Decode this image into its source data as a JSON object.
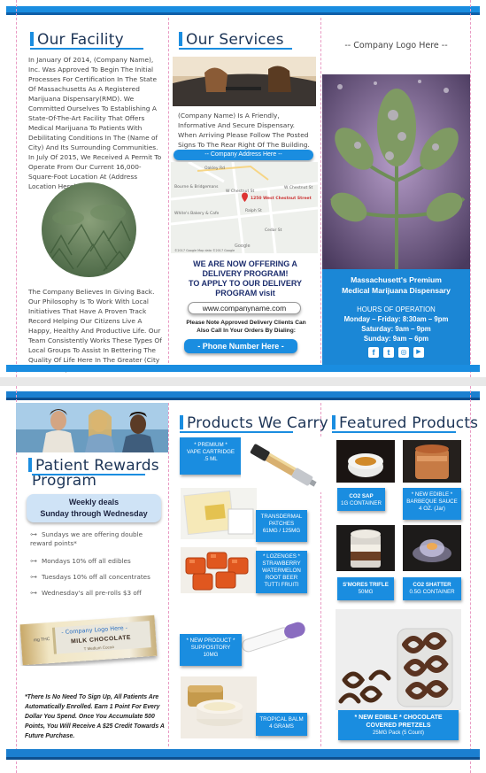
{
  "facility": {
    "title": "Our Facility",
    "text1": "In January Of 2014, (Company Name), Inc. Was Approved To Begin The Initial Processes For Certification In The State Of Massachusetts As A Registered Marijuana Dispensary(RMD). We Committed Ourselves To Establishing A State-Of-The-Art Facility That Offers Medical Marijuana To Patients With Debilitating Conditions In The (Name of City) And Its Surrounding Communities. In July Of 2015, We Received A Permit To Operate From Our Current 16,000-Square-Foot Location At (Address Location Here).",
    "text2": "The Company Believes In Giving Back. Our Philosophy Is To Work With Local Initiatives That Have A Proven Track Record Helping Our Citizens Live A Happy, Healthy And Productive Life. Our Team Consistently Works These Types Of Local Groups To Assist In Bettering The Quality Of Life Here In The Greater (City Name Here) Area."
  },
  "services": {
    "title": "Our Services",
    "text": "(Company Name) Is A Friendly, Informative And Secure Dispensary. When Arriving Please Follow The Posted Signs To The Rear Right Of The Building.",
    "address_pill": "-- Company Address Here --",
    "map": {
      "streets": [
        "W Chestnut St",
        "W Chestnut St",
        "Ralph St",
        "Cedar St",
        "Oakley Rd"
      ],
      "places": [
        "Bourne & Bridgemans",
        "White's Bakery & Cafe"
      ],
      "pin_label": "1250 West Chestnut Street",
      "google": "Google",
      "footer": "©2017 Google    Map data ©2017 Google"
    },
    "delivery_line1": "WE ARE NOW OFFERING A",
    "delivery_line2": "DELIVERY PROGRAM!",
    "delivery_line3": "TO APPLY TO OUR DELIVERY",
    "delivery_line4": "PROGRAM visit",
    "website": "www.companyname.com",
    "note": "Please Note Approved Delivery Clients Can Also Call In Your Orders By Dialing:",
    "phone": "- Phone Number Here -"
  },
  "cover": {
    "logo": "-- Company Logo Here --",
    "tag1": "Massachusett's Premium",
    "tag2": "Medical Marijuana Dispensary",
    "hours_title": "HOURS OF OPERATION",
    "hours1": "Monday – Friday: 8:30am – 9pm",
    "hours2": "Saturday: 9am – 9pm",
    "hours3": "Sunday: 9am – 6pm",
    "social": [
      "f",
      "t",
      "◎",
      "▶"
    ]
  },
  "rewards": {
    "title1": "Patient Rewards",
    "title2": "Program",
    "deals1": "Weekly deals",
    "deals2": "Sunday through Wednesday",
    "items": [
      "Sundays we are offering double reward points*",
      "Mondays 10% off all edibles",
      "Tuesdays 10% off all concentrates",
      "Wednesday's all pre-rolls $3 off"
    ],
    "bar_logo": "- Company Logo Here -",
    "bar_mg": "mg THC",
    "bar_text": "MILK CHOCOLATE",
    "bar_small": "T Medium Cocoa",
    "footnote": "*There Is No Need To Sign Up, All Patients Are Automatically Enrolled. Earn 1 Point For Every Dollar You Spend. Once You Accumulate 500 Points, You Will Receive A $25 Credit Towards A Future Purchase."
  },
  "products": {
    "title": "Products We Carry",
    "p1": [
      "* PREMIUM *",
      "VAPE CARTRIDGE",
      ".5 ML"
    ],
    "p2": [
      "TRANSDERMAL",
      "PATCHES",
      "61MG / 125MG"
    ],
    "p3": [
      "* LOZENGES *",
      "STRAWBERRY",
      "WATERMELON",
      "ROOT BEER",
      "TUTTI FRUITI"
    ],
    "p4": [
      "* NEW PRODUCT *",
      "SUPPOSITORY",
      "10MG"
    ],
    "p5": [
      "TROPICAL BALM",
      "4 GRAMS"
    ]
  },
  "featured": {
    "title": "Featured Products",
    "f1": [
      "CO2 SAP",
      "1G CONTAINER"
    ],
    "f2": [
      "* NEW EDIBLE *",
      "BARBEQUE SAUCE",
      "4 OZ. (Jar)"
    ],
    "f3": [
      "S'MORES TRIFLE",
      "50MG"
    ],
    "f4": [
      "CO2 SHATTER",
      "0.5G CONTAINER"
    ],
    "f5": [
      "* NEW EDIBLE * CHOCOLATE",
      "COVERED PRETZELS",
      "25MG Pack (5 Count)"
    ]
  }
}
